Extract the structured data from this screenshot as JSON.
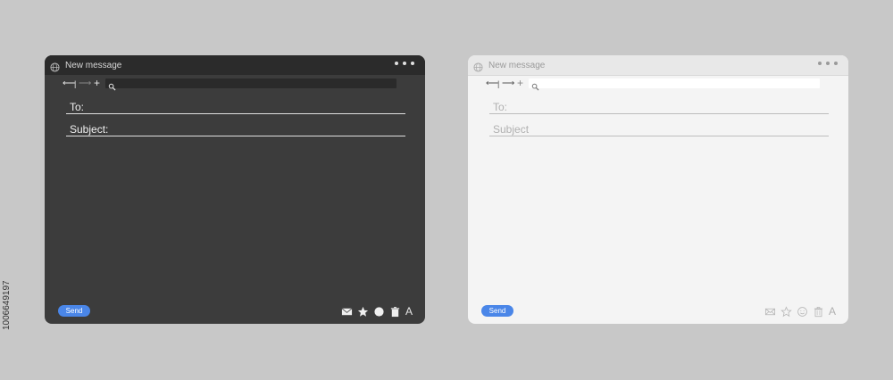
{
  "stock_id": "1006649197",
  "windows": [
    {
      "theme": "dark",
      "title": "New message",
      "nav": {
        "back": "⟵",
        "separator": "|",
        "forward": "⟶",
        "add": "+"
      },
      "fields": {
        "to_label": "To:",
        "subject_label": "Subject:"
      },
      "send_label": "Send",
      "font_label": "A",
      "icons": [
        "globe-icon",
        "more-dots-icon",
        "search-icon",
        "mail-icon",
        "star-icon",
        "emoji-icon",
        "trash-icon",
        "font-icon"
      ]
    },
    {
      "theme": "light",
      "title": "New message",
      "nav": {
        "back": "⟵",
        "separator": "|",
        "forward": "⟶",
        "add": "+"
      },
      "fields": {
        "to_label": "To:",
        "subject_label": "Subject"
      },
      "send_label": "Send",
      "font_label": "A",
      "icons": [
        "globe-icon",
        "more-dots-icon",
        "search-icon",
        "mail-icon",
        "star-icon",
        "emoji-icon",
        "trash-icon",
        "font-icon"
      ]
    }
  ],
  "colors": {
    "background": "#c8c8c8",
    "dark_window": "#3c3c3c",
    "dark_titlebar": "#2b2b2b",
    "light_window": "#f4f4f4",
    "send_button": "#4a86e8"
  }
}
